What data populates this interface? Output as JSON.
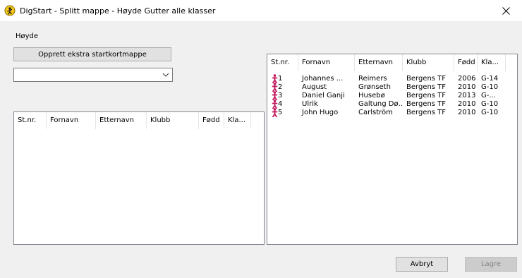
{
  "window": {
    "title": "DigStart - Splitt mappe - Høyde Gutter alle klasser",
    "icon": "digstart-logo-icon",
    "close_icon": "close-icon"
  },
  "section_label": "Høyde",
  "create_button_label": "Opprett ekstra startkortmappe",
  "dropdown": {
    "value": ""
  },
  "left_list": {
    "columns": [
      "St.nr.",
      "Fornavn",
      "Etternavn",
      "Klubb",
      "Fødd",
      "Kla..."
    ],
    "rows": []
  },
  "right_list": {
    "columns": [
      "St.nr.",
      "Fornavn",
      "Etternavn",
      "Klubb",
      "Fødd",
      "Kla..."
    ],
    "rows": [
      {
        "stnr": "1",
        "fornavn": "Johannes ...",
        "etternavn": "Reimers",
        "klubb": "Bergens TF",
        "fodd": "2006",
        "klasse": "G-14"
      },
      {
        "stnr": "2",
        "fornavn": "August",
        "etternavn": "Grønseth",
        "klubb": "Bergens TF",
        "fodd": "2010",
        "klasse": "G-10"
      },
      {
        "stnr": "3",
        "fornavn": "Daniel Ganji",
        "etternavn": "Husebø",
        "klubb": "Bergens TF",
        "fodd": "2013",
        "klasse": "G-..."
      },
      {
        "stnr": "4",
        "fornavn": "Ulrik",
        "etternavn": "Galtung Dø...",
        "klubb": "Bergens TF",
        "fodd": "2010",
        "klasse": "G-10"
      },
      {
        "stnr": "5",
        "fornavn": "John Hugo",
        "etternavn": "Carlström",
        "klubb": "Bergens TF",
        "fodd": "2010",
        "klasse": "G-10"
      }
    ],
    "row_icon": "athlete-icon"
  },
  "buttons": {
    "cancel": "Avbryt",
    "save": "Lagre"
  },
  "colors": {
    "athlete_icon": "#c2185b",
    "logo_yellow": "#f5c518"
  }
}
